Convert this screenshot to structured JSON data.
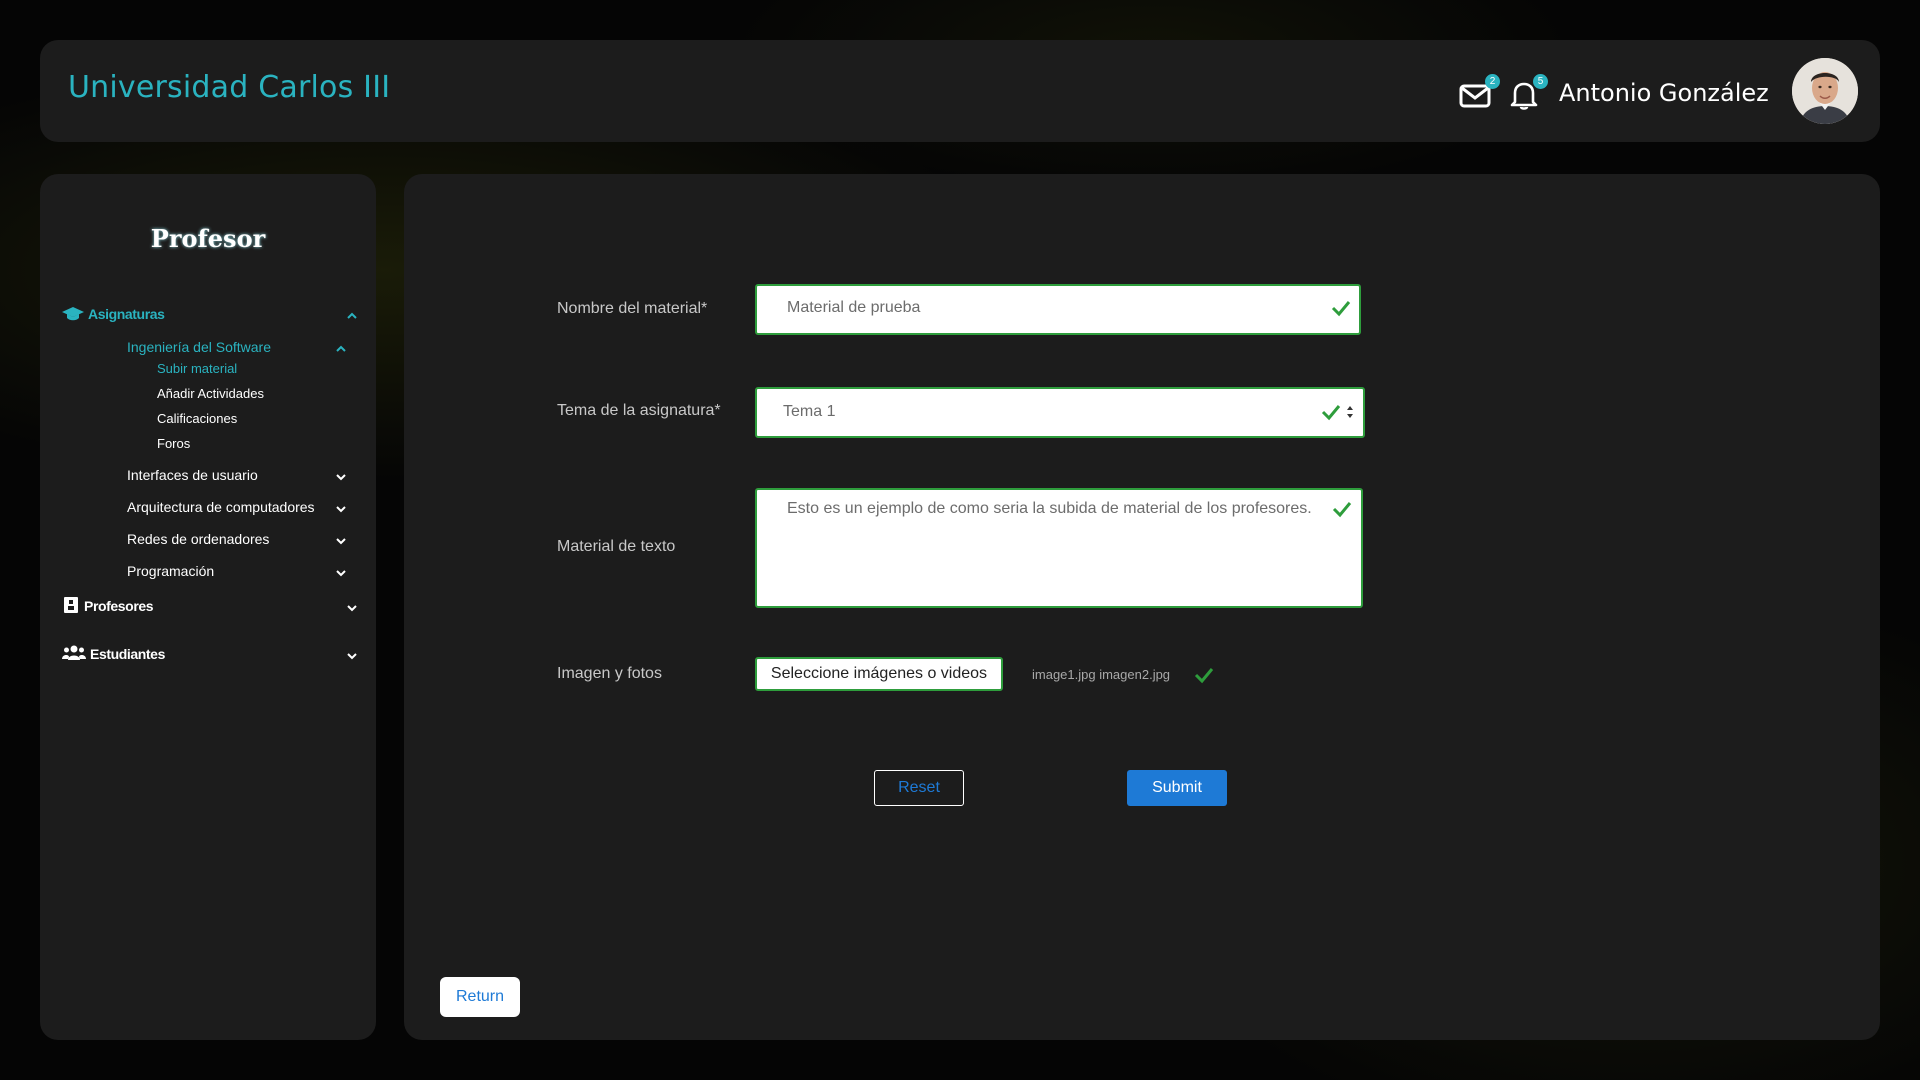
{
  "header": {
    "brand": "Universidad Carlos III",
    "mail_badge": "2",
    "bell_badge": "5",
    "user_name": "Antonio González",
    "icons": [
      "envelope-icon",
      "bell-icon",
      "chevron-down-icon",
      "avatar"
    ]
  },
  "sidebar": {
    "title": "Profesor",
    "sections": {
      "asignaturas": "Asignaturas",
      "profesores": "Profesores",
      "estudiantes": "Estudiantes"
    },
    "courses": {
      "software": "Ingeniería del Software",
      "interfaces": "Interfaces de usuario",
      "arquitectura": "Arquitectura de computadores",
      "redes": "Redes de ordenadores",
      "programacion": "Programación"
    },
    "subitems": {
      "subir": "Subir material",
      "actividades": "Añadir Actividades",
      "calificaciones": "Calificaciones",
      "foros": "Foros"
    }
  },
  "form": {
    "nombre_label": "Nombre del material*",
    "nombre_value": "Material de prueba",
    "tema_label": "Tema de la asignatura*",
    "tema_value": "Tema 1",
    "texto_label": "Material de texto",
    "texto_value": "Esto es un ejemplo de como seria la subida de material de los profesores.",
    "imagen_label": "Imagen y fotos",
    "file_button": "Seleccione imágenes o videos",
    "files": "image1.jpg imagen2.jpg",
    "reset": "Reset",
    "submit": "Submit",
    "return": "Return"
  },
  "colors": {
    "accent": "#2ab3c0",
    "valid": "#2e9d3c",
    "primary": "#1e7ad6",
    "panel": "#1c1c1c"
  }
}
